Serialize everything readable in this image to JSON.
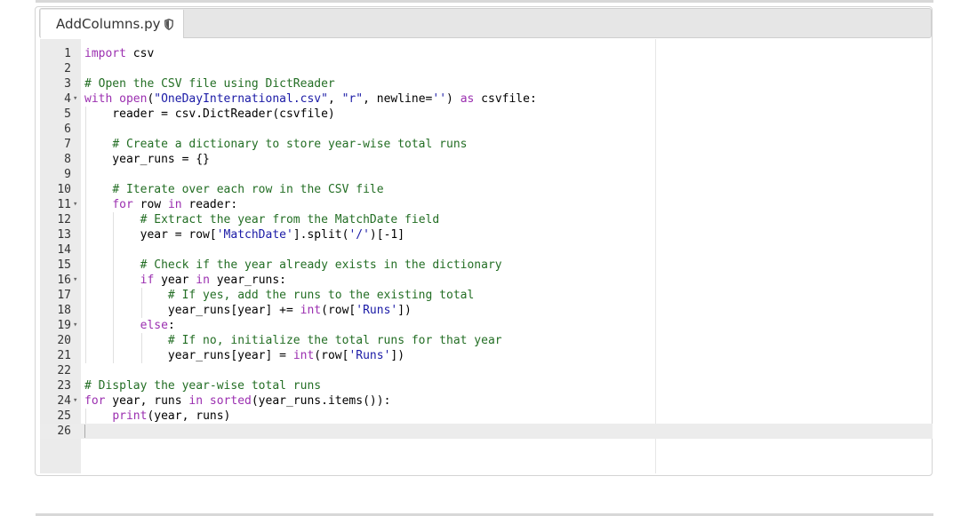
{
  "tab": {
    "filename": "AddColumns.py",
    "icon": "shield-icon"
  },
  "editor": {
    "active_line": 26,
    "lines": [
      {
        "num": "1",
        "fold": false,
        "text": "import csv"
      },
      {
        "num": "2",
        "fold": false,
        "text": ""
      },
      {
        "num": "3",
        "fold": false,
        "text": "# Open the CSV file using DictReader"
      },
      {
        "num": "4",
        "fold": true,
        "text": "with open(\"OneDayInternational.csv\", \"r\", newline='') as csvfile:"
      },
      {
        "num": "5",
        "fold": false,
        "text": "    reader = csv.DictReader(csvfile)"
      },
      {
        "num": "6",
        "fold": false,
        "text": ""
      },
      {
        "num": "7",
        "fold": false,
        "text": "    # Create a dictionary to store year-wise total runs"
      },
      {
        "num": "8",
        "fold": false,
        "text": "    year_runs = {}"
      },
      {
        "num": "9",
        "fold": false,
        "text": ""
      },
      {
        "num": "10",
        "fold": false,
        "text": "    # Iterate over each row in the CSV file"
      },
      {
        "num": "11",
        "fold": true,
        "text": "    for row in reader:"
      },
      {
        "num": "12",
        "fold": false,
        "text": "        # Extract the year from the MatchDate field"
      },
      {
        "num": "13",
        "fold": false,
        "text": "        year = row['MatchDate'].split('/')[-1]"
      },
      {
        "num": "14",
        "fold": false,
        "text": ""
      },
      {
        "num": "15",
        "fold": false,
        "text": "        # Check if the year already exists in the dictionary"
      },
      {
        "num": "16",
        "fold": true,
        "text": "        if year in year_runs:"
      },
      {
        "num": "17",
        "fold": false,
        "text": "            # If yes, add the runs to the existing total"
      },
      {
        "num": "18",
        "fold": false,
        "text": "            year_runs[year] += int(row['Runs'])"
      },
      {
        "num": "19",
        "fold": true,
        "text": "        else:"
      },
      {
        "num": "20",
        "fold": false,
        "text": "            # If no, initialize the total runs for that year"
      },
      {
        "num": "21",
        "fold": false,
        "text": "            year_runs[year] = int(row['Runs'])"
      },
      {
        "num": "22",
        "fold": false,
        "text": ""
      },
      {
        "num": "23",
        "fold": false,
        "text": "# Display the year-wise total runs"
      },
      {
        "num": "24",
        "fold": true,
        "text": "for year, runs in sorted(year_runs.items()):"
      },
      {
        "num": "25",
        "fold": false,
        "text": "    print(year, runs)"
      },
      {
        "num": "26",
        "fold": false,
        "text": ""
      }
    ]
  },
  "colors": {
    "keyword": "#9b2fb0",
    "comment": "#236e24",
    "string": "#1a1aa6",
    "gutter_bg": "#ebebeb",
    "active_line_bg": "#ececec"
  }
}
